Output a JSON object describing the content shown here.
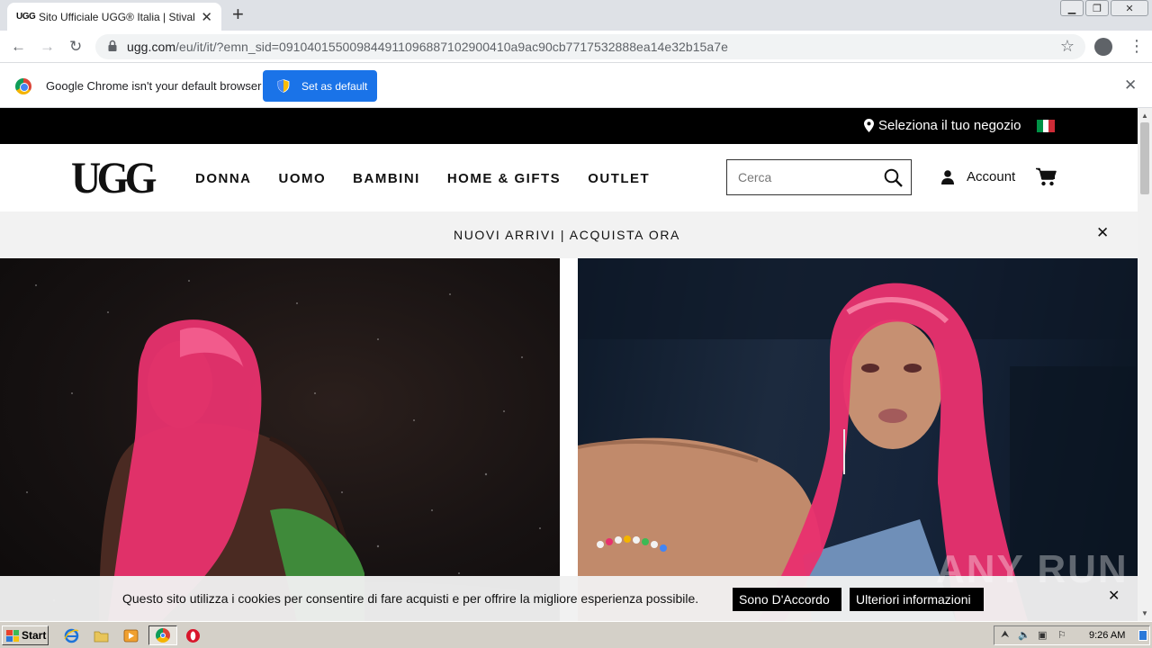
{
  "browser": {
    "tab_title": "Sito Ufficiale UGG® Italia | Stivali, Pantofole e Scarpe",
    "tab_favicon": "UGG",
    "url_host": "ugg.com",
    "url_rest": "/eu/it/it/?emn_sid=091040155009844911096887102900410a9ac90cb7717532888ea14e32b15a7e",
    "infobar_text": "Google Chrome isn't your default browser",
    "set_default_label": "Set as default"
  },
  "site": {
    "store_link": "Seleziona il tuo negozio",
    "logo": "UGG",
    "nav": [
      "DONNA",
      "UOMO",
      "BAMBINI",
      "HOME & GIFTS",
      "OUTLET"
    ],
    "search_placeholder": "Cerca",
    "account_label": "Account",
    "promo_text": "NUOVI ARRIVI | ACQUISTA ORA",
    "flag_colors": [
      "#009246",
      "#ffffff",
      "#ce2b37"
    ]
  },
  "cookie": {
    "text": "Questo sito utilizza i cookies per consentire di fare acquisti e per offrire la migliore esperienza possibile.",
    "accept_label": "Sono D'Accordo",
    "more_label": "Ulteriori informazioni"
  },
  "watermark": "ANY RUN",
  "taskbar": {
    "start_label": "Start",
    "clock": "9:26 AM"
  },
  "colors": {
    "accent_blue": "#1a73e8",
    "hair_pink": "#e8316e"
  }
}
